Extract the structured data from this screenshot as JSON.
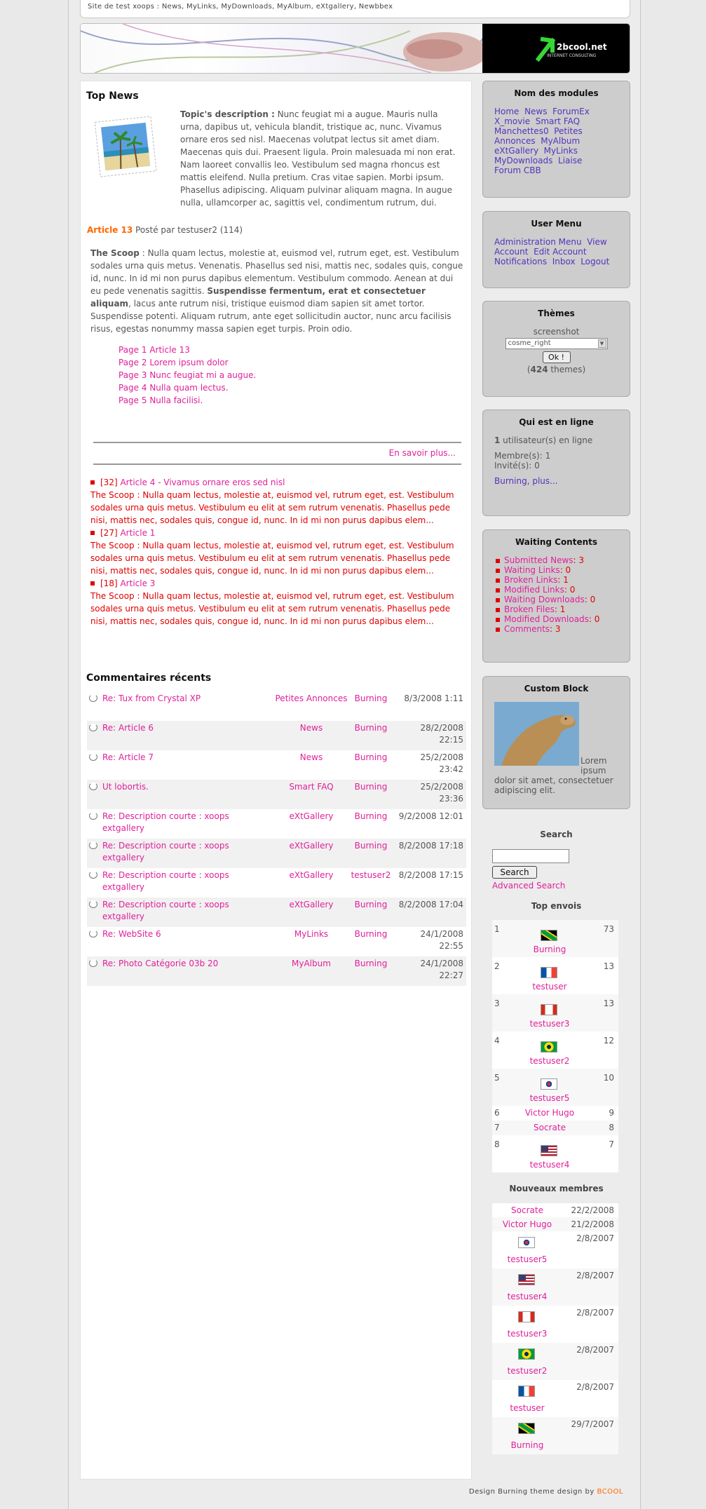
{
  "site_bar": "Site de test xoops : News, MyLinks, MyDownloads, MyAlbum, eXtgallery, Newbbex",
  "banner_logo": {
    "name": "2bcool.net",
    "tagline": "INTERNET CONSULTING"
  },
  "top_news": {
    "title": "Top News",
    "topic_label": "Topic's description :",
    "topic_text": "Nunc feugiat mi a augue. Mauris nulla urna, dapibus ut, vehicula blandit, tristique ac, nunc. Vivamus ornare eros sed nisl. Maecenas volutpat lectus sit amet diam. Maecenas quis dui. Praesent ligula. Proin malesuada mi non erat. Nam laoreet convallis leo. Vestibulum sed magna rhoncus est mattis eleifend. Nulla pretium. Cras vitae sapien. Morbi ipsum. Phasellus adipiscing. Aliquam pulvinar aliquam magna. In augue nulla, ullamcorper ac, sagittis vel, condimentum rutrum, dui.",
    "article_link": "Article 13",
    "posted_by": "Posté par testuser2 (114)",
    "scoop_label": "The Scoop",
    "scoop_text_1": " : Nulla quam lectus, molestie at, euismod vel, rutrum eget, est. Vestibulum sodales urna quis metus. Venenatis. Phasellus sed nisi, mattis nec, sodales quis, congue id, nunc. In id mi non purus dapibus elementum. Vestibulum commodo. Aenean at dui eu pede venenatis sagittis. ",
    "scoop_bold": "Suspendisse fermentum, erat et consectetuer aliquam",
    "scoop_text_2": ", lacus ante rutrum nisi, tristique euismod diam sapien sit amet tortor. Suspendisse potenti. Aliquam rutrum, ante eget sollicitudin auctor, nunc arcu facilisis risus, egestas nonummy massa sapien eget turpis. Proin odio.",
    "pages": [
      "Page 1 Article 13",
      "Page 2 Lorem ipsum dolor",
      "Page 3 Nunc feugiat mi a augue.",
      "Page 4 Nulla quam lectus.",
      "Page 5 Nulla facilisi."
    ],
    "read_more": "En savoir plus..."
  },
  "news_list": [
    {
      "id": "[32]",
      "title": "Article 4 - Vivamus ornare eros sed nisl",
      "text": "The Scoop : Nulla quam lectus, molestie at, euismod vel, rutrum eget, est. Vestibulum sodales urna quis metus. Vestibulum eu elit at sem rutrum venenatis. Phasellus pede nisi, mattis nec, sodales quis, congue id, nunc. In id mi non purus dapibus elem..."
    },
    {
      "id": "[27]",
      "title": "Article 1",
      "text": "The Scoop : Nulla quam lectus, molestie at, euismod vel, rutrum eget, est. Vestibulum sodales urna quis metus. Vestibulum eu elit at sem rutrum venenatis. Phasellus pede nisi, mattis nec, sodales quis, congue id, nunc. In id mi non purus dapibus elem..."
    },
    {
      "id": "[18]",
      "title": "Article 3",
      "text": "The Scoop : Nulla quam lectus, molestie at, euismod vel, rutrum eget, est. Vestibulum sodales urna quis metus. Vestibulum eu elit at sem rutrum venenatis. Phasellus pede nisi, mattis nec, sodales quis, congue id, nunc. In id mi non purus dapibus elem..."
    }
  ],
  "comments": {
    "title": "Commentaires récents",
    "rows": [
      {
        "title": "Re: Tux from Crystal XP",
        "module": "Petites Annonces",
        "user": "Burning",
        "date": "8/3/2008 1:11"
      },
      {
        "title": "Re: Article 6",
        "module": "News",
        "user": "Burning",
        "date": "28/2/2008 22:15"
      },
      {
        "title": "Re: Article 7",
        "module": "News",
        "user": "Burning",
        "date": "25/2/2008 23:42"
      },
      {
        "title": "Ut lobortis.",
        "module": "Smart FAQ",
        "user": "Burning",
        "date": "25/2/2008 23:36"
      },
      {
        "title": "Re: Description courte : xoops extgallery",
        "module": "eXtGallery",
        "user": "Burning",
        "date": "9/2/2008 12:01"
      },
      {
        "title": "Re: Description courte : xoops extgallery",
        "module": "eXtGallery",
        "user": "Burning",
        "date": "8/2/2008 17:18"
      },
      {
        "title": "Re: Description courte : xoops extgallery",
        "module": "eXtGallery",
        "user": "testuser2",
        "date": "8/2/2008 17:15"
      },
      {
        "title": "Re: Description courte : xoops extgallery",
        "module": "eXtGallery",
        "user": "Burning",
        "date": "8/2/2008 17:04"
      },
      {
        "title": "Re: WebSite 6",
        "module": "MyLinks",
        "user": "Burning",
        "date": "24/1/2008 22:55"
      },
      {
        "title": "Re: Photo Catégorie 03b 20",
        "module": "MyAlbum",
        "user": "Burning",
        "date": "24/1/2008 22:27"
      }
    ]
  },
  "modules_block": {
    "title": "Nom des modules",
    "lines": [
      "Home  News  ForumEx",
      "X_movie  Smart FAQ",
      "Manchettes0  Petites",
      "Annonces  MyAlbum",
      "eXtGallery  MyLinks",
      "MyDownloads  Liaise",
      "Forum CBB"
    ]
  },
  "user_menu": {
    "title": "User Menu",
    "lines": [
      "Administration Menu  View",
      "Account  Edit Account",
      "Notifications  Inbox  Logout"
    ]
  },
  "themes_block": {
    "title": "Thèmes",
    "screenshot_label": "screenshot",
    "selected": "cosme_right",
    "ok_label": "Ok !",
    "count_prefix": "(",
    "count": "424",
    "count_suffix": " themes)"
  },
  "online_block": {
    "title": "Qui est en ligne",
    "users_prefix": "1",
    "users_suffix": " utilisateur(s) en ligne",
    "members": "Membre(s): 1",
    "guests": "Invité(s): 0",
    "link": "Burning, plus..."
  },
  "waiting_block": {
    "title": "Waiting Contents",
    "items": [
      {
        "label": "Submitted News",
        "value": ": 3"
      },
      {
        "label": "Waiting Links",
        "value": ": 0"
      },
      {
        "label": "Broken Links",
        "value": ": 1"
      },
      {
        "label": "Modified Links",
        "value": ": 0"
      },
      {
        "label": "Waiting Downloads",
        "value": ": 0"
      },
      {
        "label": "Broken Files",
        "value": ": 1"
      },
      {
        "label": "Modified Downloads",
        "value": ": 0"
      },
      {
        "label": "Comments",
        "value": ": 3"
      }
    ]
  },
  "custom_block": {
    "title": "Custom Block",
    "text": "Lorem ipsum dolor sit amet, consectetuer adipiscing elit."
  },
  "search_block": {
    "title": "Search",
    "value": "",
    "button": "Search",
    "advanced": "Advanced Search"
  },
  "top_posters": {
    "title": "Top envois",
    "rows": [
      {
        "rank": "1",
        "name": "Burning",
        "count": "73",
        "flag": "jamaica"
      },
      {
        "rank": "2",
        "name": "testuser",
        "count": "13",
        "flag": "france"
      },
      {
        "rank": "3",
        "name": "testuser3",
        "count": "13",
        "flag": "canada"
      },
      {
        "rank": "4",
        "name": "testuser2",
        "count": "12",
        "flag": "brazil"
      },
      {
        "rank": "5",
        "name": "testuser5",
        "count": "10",
        "flag": "korea"
      },
      {
        "rank": "6",
        "name": "Victor Hugo",
        "count": "9",
        "flag": ""
      },
      {
        "rank": "7",
        "name": "Socrate",
        "count": "8",
        "flag": ""
      },
      {
        "rank": "8",
        "name": "testuser4",
        "count": "7",
        "flag": "usa"
      }
    ]
  },
  "new_members": {
    "title": "Nouveaux membres",
    "rows": [
      {
        "name": "Socrate",
        "date": "22/2/2008",
        "flag": ""
      },
      {
        "name": "Victor Hugo",
        "date": "21/2/2008",
        "flag": ""
      },
      {
        "name": "testuser5",
        "date": "2/8/2007",
        "flag": "korea"
      },
      {
        "name": "testuser4",
        "date": "2/8/2007",
        "flag": "usa"
      },
      {
        "name": "testuser3",
        "date": "2/8/2007",
        "flag": "canada"
      },
      {
        "name": "testuser2",
        "date": "2/8/2007",
        "flag": "brazil"
      },
      {
        "name": "testuser",
        "date": "2/8/2007",
        "flag": "france"
      },
      {
        "name": "Burning",
        "date": "29/7/2007",
        "flag": "jamaica"
      }
    ]
  },
  "footer": {
    "text": "Design Burning theme design by ",
    "link": "BCOOL"
  }
}
